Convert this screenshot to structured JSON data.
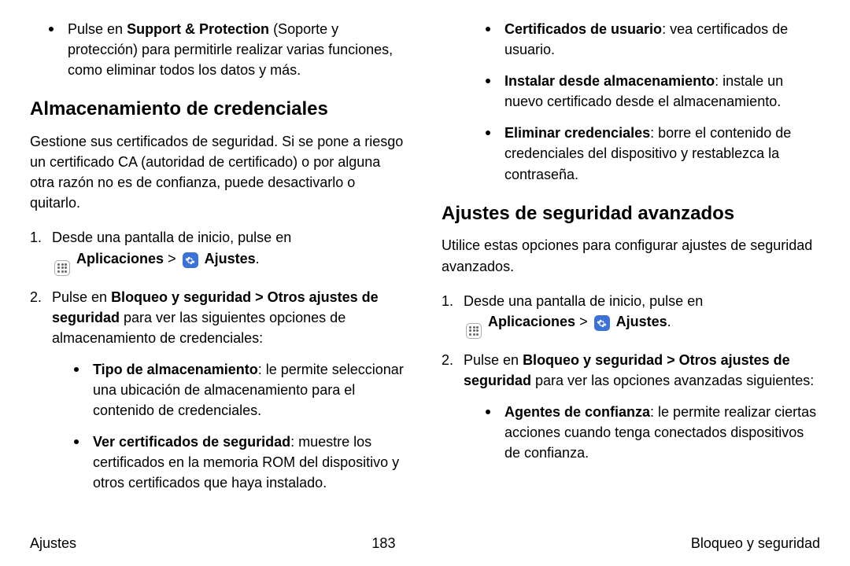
{
  "left": {
    "top_bullet": {
      "pre": "Pulse en ",
      "bold": "Support & Protection",
      "post": " (Soporte y protección) para permitirle realizar varias funciones, como eliminar todos los datos y más."
    },
    "h3": "Almacenamiento de credenciales",
    "intro": "Gestione sus certificados de seguridad. Si se pone a riesgo un certificado CA (autoridad de certificado) o por alguna otra razón no es de confianza, puede desactivarlo o quitarlo.",
    "step1_a": "Desde una pantalla de inicio, pulse en ",
    "step1_apps": "Aplicaciones",
    "step1_sep": " > ",
    "step1_settings": "Ajustes",
    "step1_end": ".",
    "step2_pre": "Pulse en ",
    "step2_bold": "Bloqueo y seguridad > Otros ajustes de seguridad",
    "step2_post": " para ver las siguientes opciones de almacenamiento de credenciales:",
    "sub": [
      {
        "bold": "Tipo de almacenamiento",
        "text": ": le permite seleccionar una ubicación de almacenamiento para el contenido de credenciales."
      },
      {
        "bold": "Ver certificados de seguridad",
        "text": ": muestre los certificados en la memoria ROM del dispositivo y otros certificados que haya instalado."
      }
    ]
  },
  "right": {
    "top_bullets": [
      {
        "bold": "Certificados de usuario",
        "text": ": vea certificados de usuario."
      },
      {
        "bold": "Instalar desde almacenamiento",
        "text": ": instale un nuevo certificado desde el almacenamiento."
      },
      {
        "bold": "Eliminar credenciales",
        "text": ": borre el contenido de credenciales del dispositivo y restablezca la contraseña."
      }
    ],
    "h3": "Ajustes de seguridad avanzados",
    "intro": "Utilice estas opciones para configurar ajustes de seguridad avanzados.",
    "step1_a": "Desde una pantalla de inicio, pulse en ",
    "step1_apps": "Aplicaciones",
    "step1_sep": " > ",
    "step1_settings": "Ajustes",
    "step1_end": ".",
    "step2_pre": "Pulse en ",
    "step2_bold": "Bloqueo y seguridad > Otros ajustes de seguridad",
    "step2_post": " para ver las opciones avanzadas siguientes:",
    "sub": [
      {
        "bold": "Agentes de confianza",
        "text": ": le permite realizar ciertas acciones cuando tenga conectados dispositivos de confianza."
      }
    ]
  },
  "footer": {
    "left": "Ajustes",
    "center": "183",
    "right": "Bloqueo y seguridad"
  }
}
